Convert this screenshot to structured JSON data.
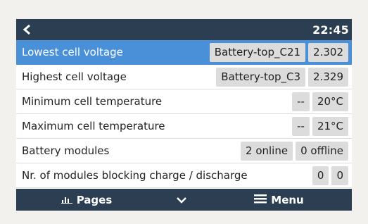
{
  "header": {
    "time": "22:45"
  },
  "rows": [
    {
      "label": "Lowest cell voltage",
      "values": [
        "Battery-top_C21",
        "2.302"
      ]
    },
    {
      "label": "Highest cell voltage",
      "values": [
        "Battery-top_C3",
        "2.329"
      ]
    },
    {
      "label": "Minimum cell temperature",
      "values": [
        "--",
        "20°C"
      ]
    },
    {
      "label": "Maximum cell temperature",
      "values": [
        "--",
        "21°C"
      ]
    },
    {
      "label": "Battery modules",
      "values": [
        "2 online",
        "0 offline"
      ]
    },
    {
      "label": "Nr. of modules blocking charge / discharge",
      "values": [
        "0",
        "0"
      ]
    }
  ],
  "footer": {
    "pages_label": "Pages",
    "menu_label": "Menu"
  },
  "colors": {
    "bar": "#2b3e52",
    "selected": "#4a90d9",
    "value_box": "#dcdcdc"
  },
  "icons": {
    "back": "chevron-left-icon",
    "pages": "bar-chart-icon",
    "down": "chevron-down-icon",
    "menu": "hamburger-icon"
  }
}
